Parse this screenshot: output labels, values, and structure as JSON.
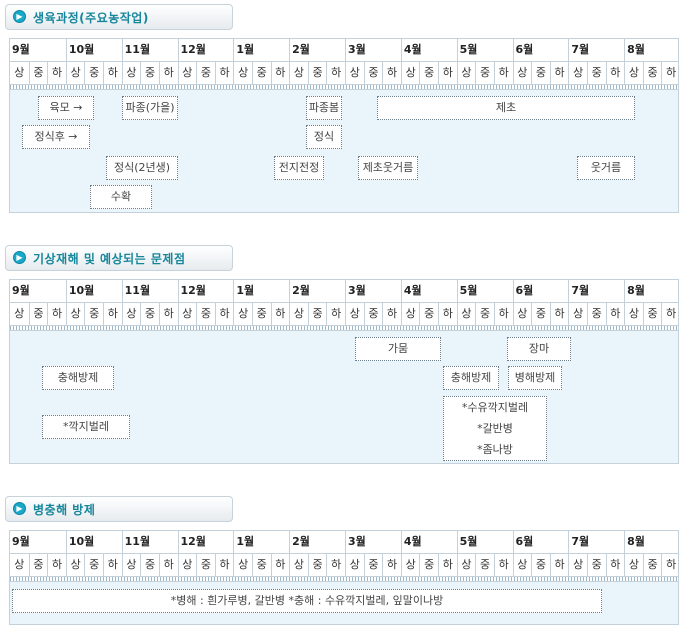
{
  "months": [
    "9월",
    "10월",
    "11월",
    "12월",
    "1월",
    "2월",
    "3월",
    "4월",
    "5월",
    "6월",
    "7월",
    "8월"
  ],
  "subdivisions": [
    "상",
    "중",
    "하"
  ],
  "sections": [
    {
      "title": "생육과정(주요농작업)",
      "items": [
        {
          "label": "육모 →"
        },
        {
          "label": "파종(가을)"
        },
        {
          "label": "파종봄"
        },
        {
          "label": "제초"
        },
        {
          "label": "정식후 →"
        },
        {
          "label": "정식"
        },
        {
          "label": "정식(2년생)"
        },
        {
          "label": "전지전정"
        },
        {
          "label": "제초웃거름"
        },
        {
          "label": "웃거름"
        },
        {
          "label": "수확"
        }
      ]
    },
    {
      "title": "기상재해 및 예상되는 문제점",
      "items": [
        {
          "label": "가뭄"
        },
        {
          "label": "장마"
        },
        {
          "label": "충해방제"
        },
        {
          "label": "충해방제"
        },
        {
          "label": "병해방제"
        },
        {
          "label": "*깍지벌레"
        },
        {
          "lines": [
            "*수유깍지벌레",
            "*갈반병",
            "*좀나방"
          ]
        }
      ]
    },
    {
      "title": "병충해 방제",
      "items": [
        {
          "label": "*병해 : 흰가루병, 갈반병 *충해 : 수유깍지벌레, 잎말이나방"
        }
      ]
    }
  ]
}
